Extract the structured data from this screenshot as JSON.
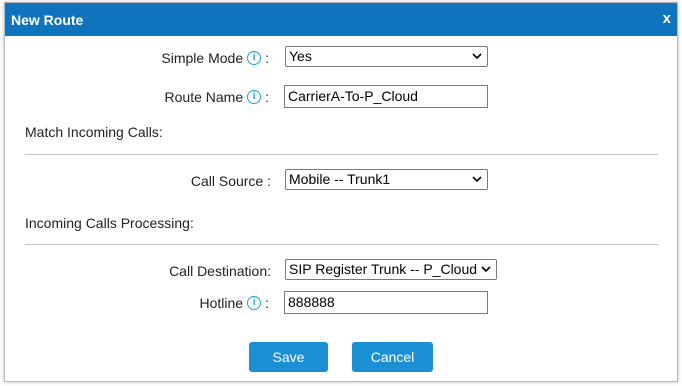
{
  "dialog": {
    "title": "New Route",
    "close_label": "x"
  },
  "form": {
    "simple_mode": {
      "label": "Simple Mode",
      "value": "Yes"
    },
    "route_name": {
      "label": "Route Name",
      "value": "CarrierA-To-P_Cloud"
    },
    "match_section": "Match Incoming Calls:",
    "call_source": {
      "label": "Call Source :",
      "value": "Mobile -- Trunk1"
    },
    "processing_section": "Incoming Calls Processing:",
    "call_destination": {
      "label": "Call Destination:",
      "value": "SIP Register Trunk -- P_Cloud"
    },
    "hotline": {
      "label": "Hotline",
      "value": "888888"
    },
    "info_glyph": "i",
    "colon": ":"
  },
  "buttons": {
    "save": "Save",
    "cancel": "Cancel"
  },
  "colors": {
    "titlebar": "#0f74bd",
    "button": "#1b8fd4",
    "info_icon": "#1ba3d8"
  }
}
